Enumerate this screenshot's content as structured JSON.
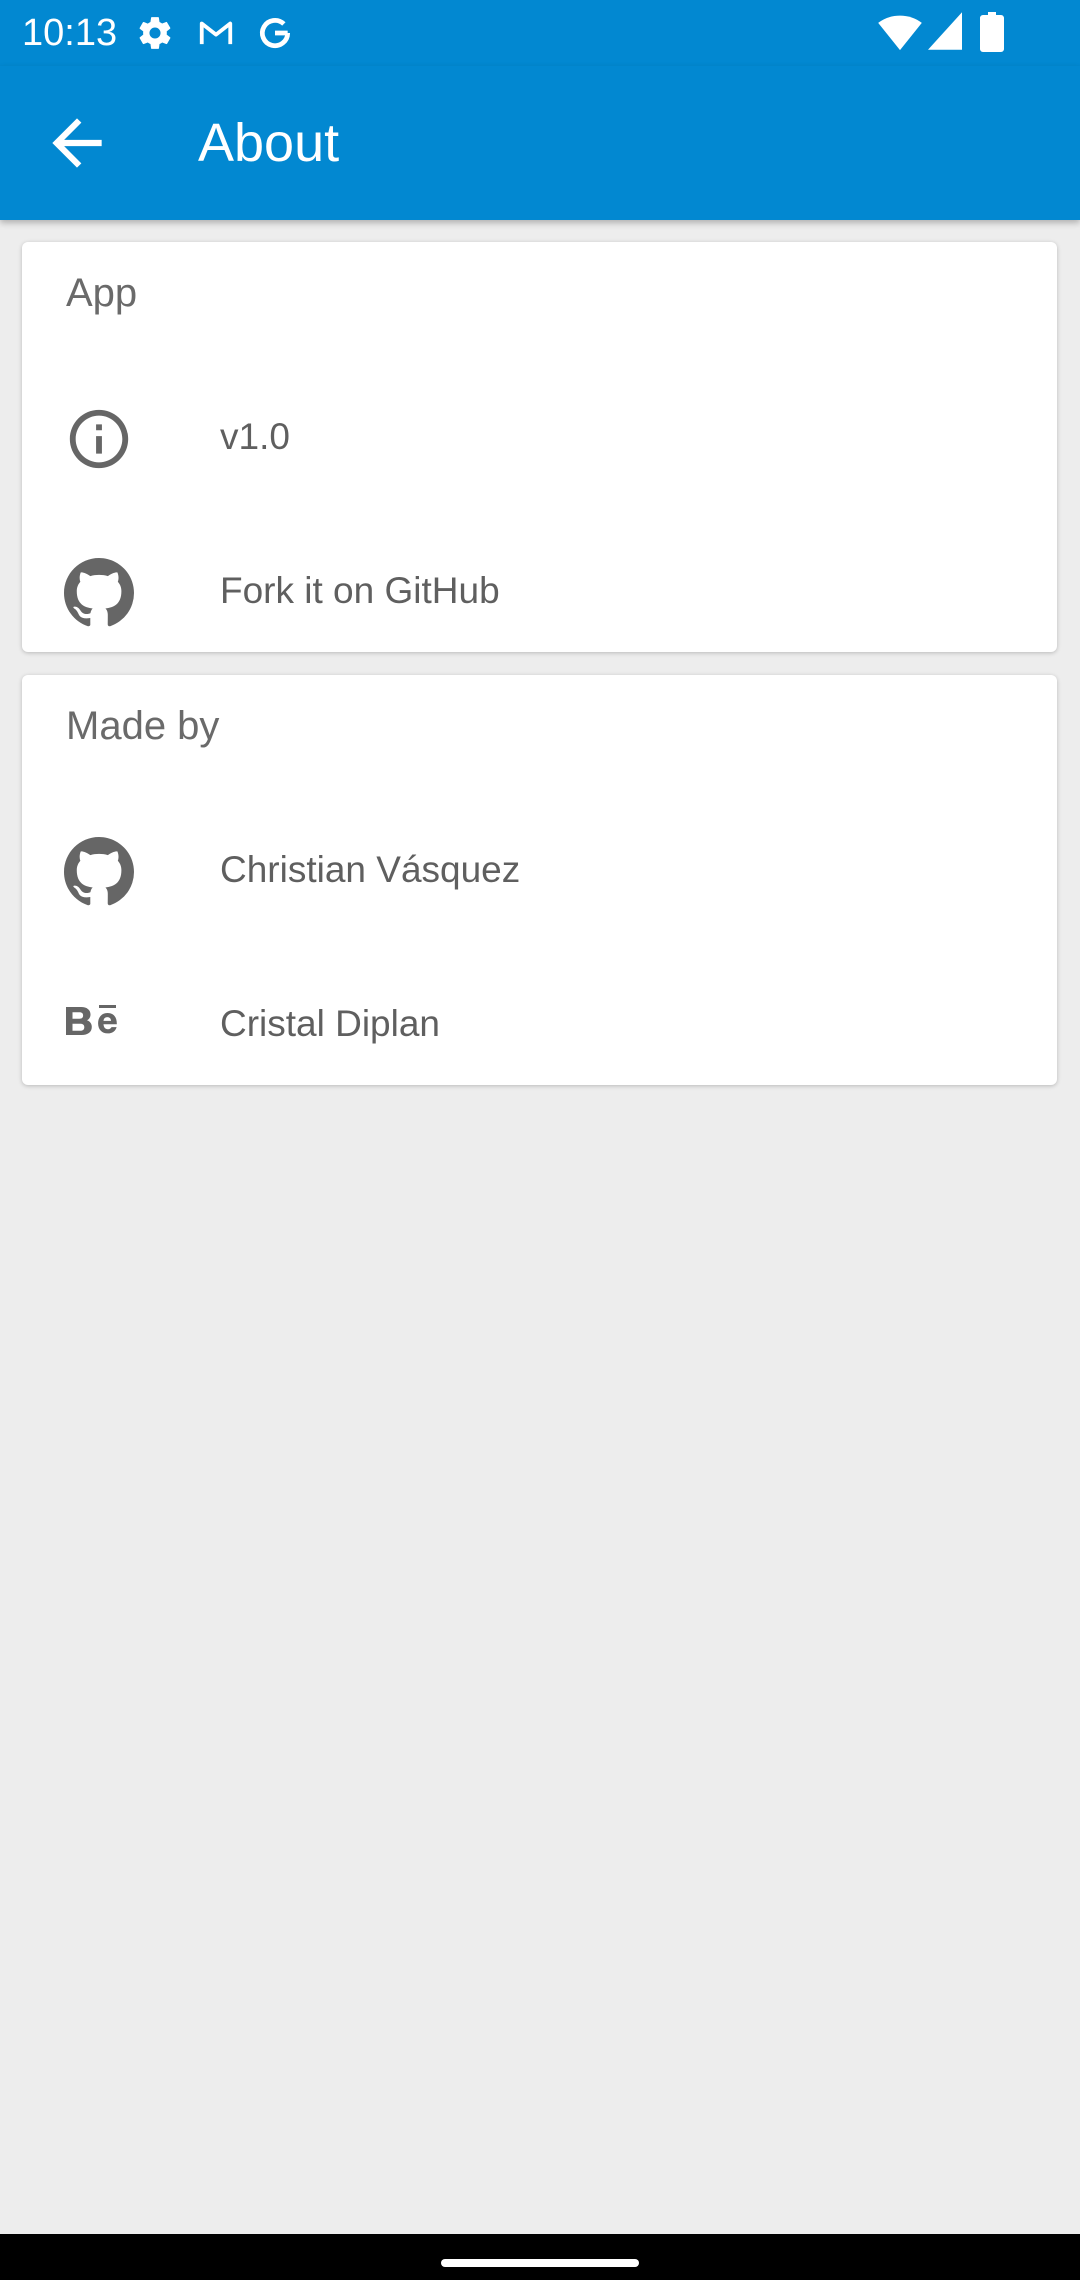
{
  "status_bar": {
    "time": "10:13",
    "left_icons": [
      "settings-icon",
      "gmail-icon",
      "google-icon"
    ],
    "right_icons": [
      "wifi-icon",
      "signal-icon",
      "battery-icon"
    ],
    "color": "#0288d1"
  },
  "app_bar": {
    "title": "About",
    "back_icon": "arrow-back-icon",
    "color": "#0288d1"
  },
  "sections": [
    {
      "header": "App",
      "items": [
        {
          "icon": "info-icon",
          "label": "v1.0"
        },
        {
          "icon": "github-icon",
          "label": "Fork it on GitHub"
        }
      ]
    },
    {
      "header": "Made by",
      "items": [
        {
          "icon": "github-icon",
          "label": "Christian Vásquez"
        },
        {
          "icon": "behance-icon",
          "label": "Cristal Diplan"
        }
      ]
    }
  ]
}
